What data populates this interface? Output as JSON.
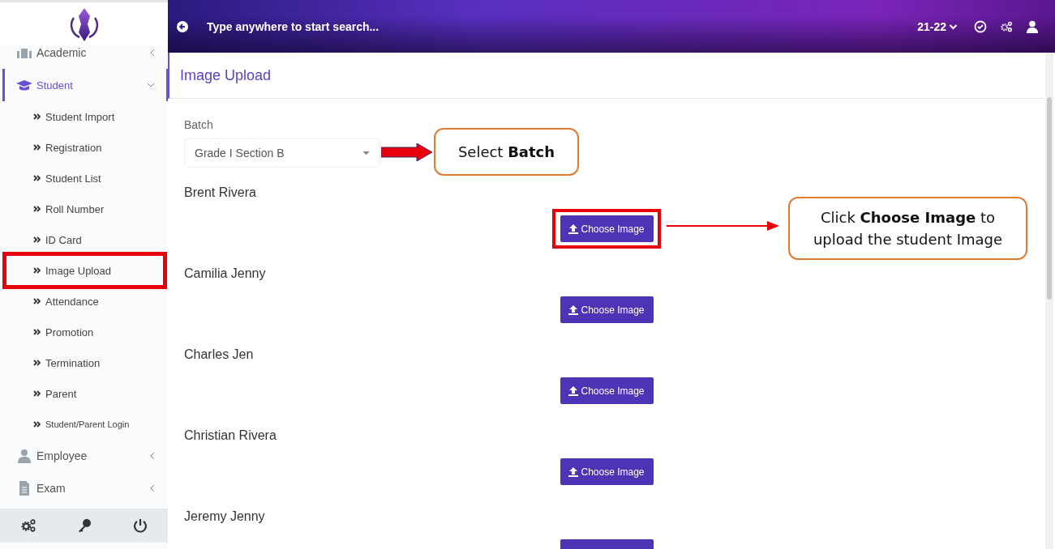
{
  "topbar": {
    "search": {
      "placeholder": "Type anywhere to start search..."
    },
    "session": "21-22"
  },
  "sidebar": {
    "items": [
      {
        "label": "Academic",
        "selected": false,
        "expanded": false
      },
      {
        "label": "Student",
        "selected": true,
        "expanded": true,
        "children": [
          {
            "label": "Student Import",
            "highlighted": false,
            "small": false
          },
          {
            "label": "Registration",
            "highlighted": false,
            "small": false
          },
          {
            "label": "Student List",
            "highlighted": false,
            "small": false
          },
          {
            "label": "Roll Number",
            "highlighted": false,
            "small": false
          },
          {
            "label": "ID Card",
            "highlighted": false,
            "small": false
          },
          {
            "label": "Image Upload",
            "highlighted": true,
            "small": false
          },
          {
            "label": "Attendance",
            "highlighted": false,
            "small": false
          },
          {
            "label": "Promotion",
            "highlighted": false,
            "small": false
          },
          {
            "label": "Termination",
            "highlighted": false,
            "small": false
          },
          {
            "label": "Parent",
            "highlighted": false,
            "small": false
          },
          {
            "label": "Student/Parent Login",
            "highlighted": false,
            "small": true
          }
        ]
      },
      {
        "label": "Employee",
        "selected": false,
        "expanded": false
      },
      {
        "label": "Exam",
        "selected": false,
        "expanded": false
      }
    ]
  },
  "page": {
    "title": "Image Upload",
    "batch": {
      "label": "Batch",
      "value": "Grade I Section B"
    },
    "students": [
      {
        "name": "Brent Rivera",
        "button": "Choose Image",
        "highlighted": true
      },
      {
        "name": "Camilia Jenny",
        "button": "Choose Image",
        "highlighted": false
      },
      {
        "name": "Charles Jen",
        "button": "Choose Image",
        "highlighted": false
      },
      {
        "name": "Christian Rivera",
        "button": "Choose Image",
        "highlighted": false
      },
      {
        "name": "Jeremy Jenny",
        "highlighted": false
      }
    ]
  },
  "annotations": [
    {
      "kind": "block-arrow",
      "text": "Select **Batch**"
    },
    {
      "kind": "line-arrow",
      "text": "Click **Choose Image** to upload the student Image"
    }
  ]
}
